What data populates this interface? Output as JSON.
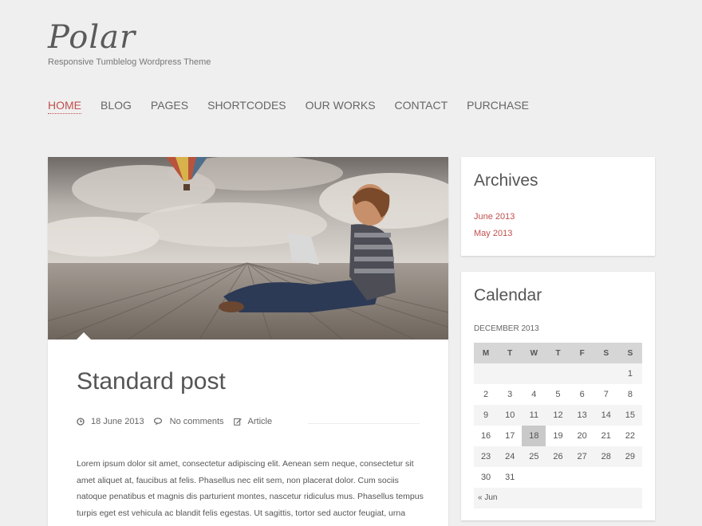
{
  "site": {
    "logo": "Polar",
    "tagline": "Responsive Tumblelog Wordpress Theme"
  },
  "nav": {
    "items": [
      {
        "label": "HOME",
        "active": true
      },
      {
        "label": "BLOG"
      },
      {
        "label": "PAGES"
      },
      {
        "label": "SHORTCODES"
      },
      {
        "label": "OUR WORKS"
      },
      {
        "label": "CONTACT"
      },
      {
        "label": "PURCHASE"
      }
    ]
  },
  "post": {
    "title": "Standard post",
    "date": "18 June 2013",
    "comments": "No comments",
    "category": "Article",
    "excerpt": "Lorem ipsum dolor sit amet, consectetur adipiscing elit. Aenean sem neque, consectetur sit amet aliquet at, faucibus at felis. Phasellus nec elit sem, non placerat dolor. Cum sociis natoque penatibus et magnis dis parturient montes, nascetur ridiculus mus. Phasellus tempus turpis eget est vehicula ac blandit felis egestas. Ut sagittis, tortor sed auctor feugiat, urna",
    "icons": [
      "clock-icon",
      "comments-icon",
      "pencil-icon"
    ]
  },
  "archives": {
    "title": "Archives",
    "links": [
      "June 2013",
      "May 2013"
    ]
  },
  "calendar": {
    "title": "Calendar",
    "caption": "DECEMBER 2013",
    "days": [
      "M",
      "T",
      "W",
      "T",
      "F",
      "S",
      "S"
    ],
    "weeks": [
      [
        "",
        "",
        "",
        "",
        "",
        "",
        "1"
      ],
      [
        "2",
        "3",
        "4",
        "5",
        "6",
        "7",
        "8"
      ],
      [
        "9",
        "10",
        "11",
        "12",
        "13",
        "14",
        "15"
      ],
      [
        "16",
        "17",
        "18",
        "19",
        "20",
        "21",
        "22"
      ],
      [
        "23",
        "24",
        "25",
        "26",
        "27",
        "28",
        "29"
      ],
      [
        "30",
        "31",
        "",
        "",
        "",
        "",
        ""
      ]
    ],
    "today": "18",
    "prev": "« Jun"
  },
  "colors": {
    "accent": "#c0504d",
    "background": "#efefef",
    "card": "#ffffff"
  }
}
